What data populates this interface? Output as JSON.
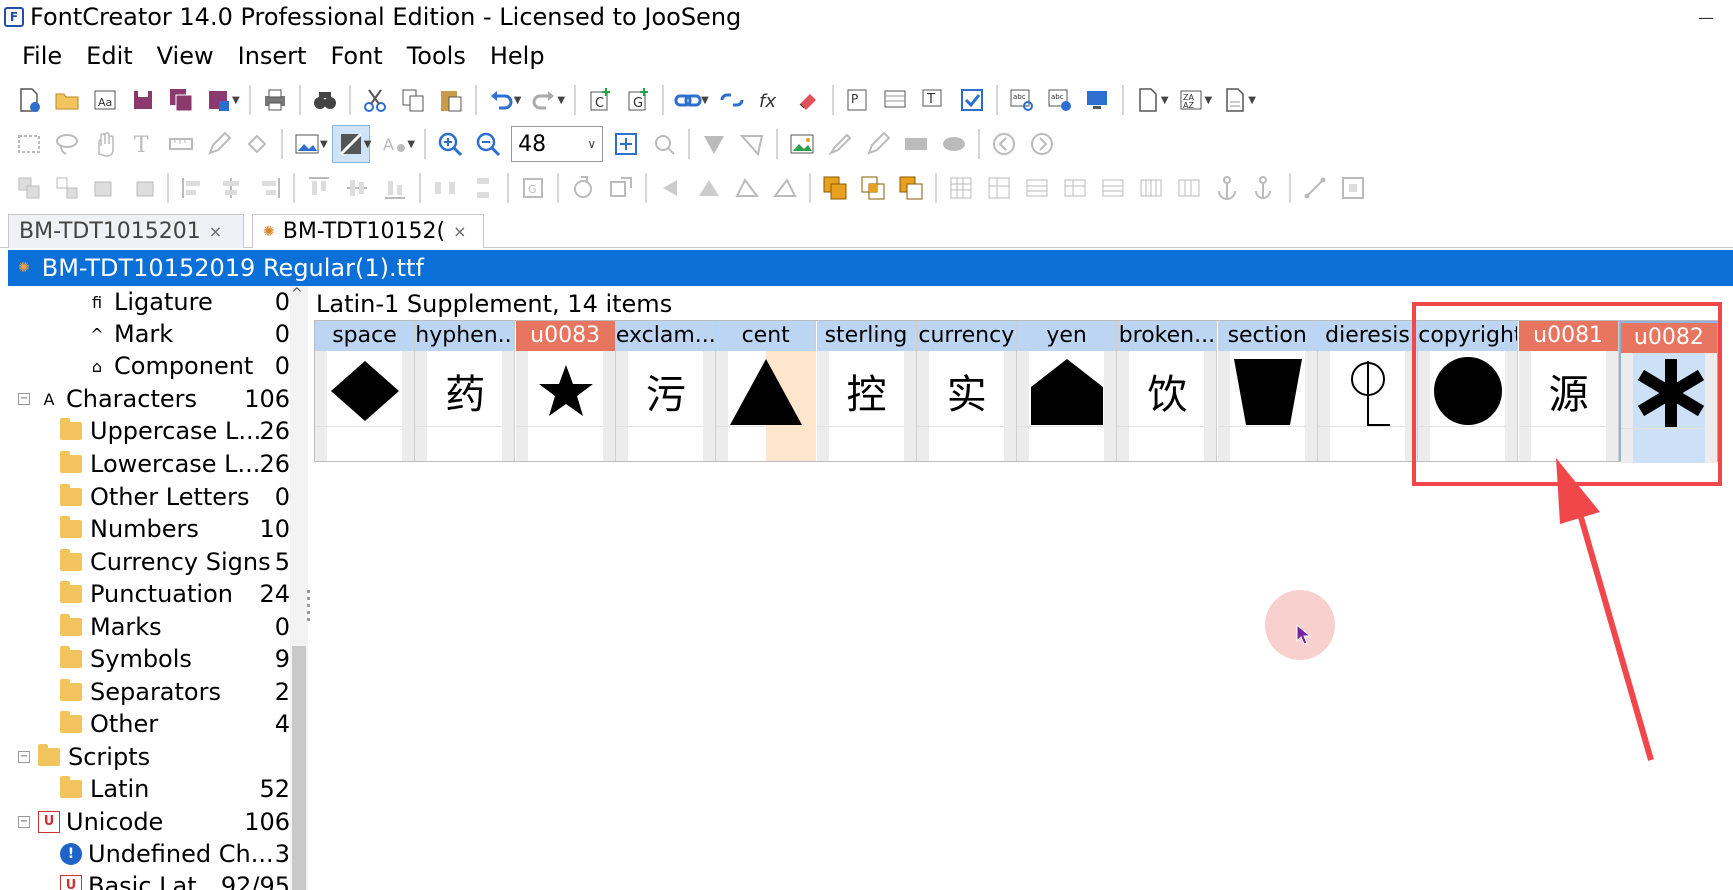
{
  "window": {
    "title": "FontCreator 14.0 Professional Edition - Licensed to JooSeng",
    "minimize": "—"
  },
  "menu": [
    "File",
    "Edit",
    "View",
    "Insert",
    "Font",
    "Tools",
    "Help"
  ],
  "toolbar": {
    "zoom_value": "48"
  },
  "tabs": [
    {
      "label": "BM-TDT1015201"
    },
    {
      "label": "BM-TDT10152("
    }
  ],
  "document": {
    "title": "BM-TDT10152019 Regular(1).ttf"
  },
  "tree": [
    {
      "label": "Ligature",
      "count": "0",
      "icon": "ligature-icon",
      "glyph": "ﬁ"
    },
    {
      "label": "Mark",
      "count": "0",
      "icon": "mark-icon",
      "glyph": "^"
    },
    {
      "label": "Component",
      "count": "0",
      "icon": "component-icon",
      "glyph": "⌂"
    },
    {
      "label": "Characters",
      "count": "106",
      "icon": "characters-icon",
      "glyph": "A"
    },
    {
      "label": "Uppercase L...",
      "count": "26",
      "icon": "folder-icon"
    },
    {
      "label": "Lowercase L...",
      "count": "26",
      "icon": "folder-icon"
    },
    {
      "label": "Other Letters",
      "count": "0",
      "icon": "folder-icon"
    },
    {
      "label": "Numbers",
      "count": "10",
      "icon": "folder-icon"
    },
    {
      "label": "Currency Signs",
      "count": "5",
      "icon": "folder-icon"
    },
    {
      "label": "Punctuation",
      "count": "24",
      "icon": "folder-icon"
    },
    {
      "label": "Marks",
      "count": "0",
      "icon": "folder-icon"
    },
    {
      "label": "Symbols",
      "count": "9",
      "icon": "folder-icon"
    },
    {
      "label": "Separators",
      "count": "2",
      "icon": "folder-icon"
    },
    {
      "label": "Other",
      "count": "4",
      "icon": "folder-icon"
    },
    {
      "label": "Scripts",
      "count": "",
      "icon": "folder-icon"
    },
    {
      "label": "Latin",
      "count": "52",
      "icon": "folder-icon"
    },
    {
      "label": "Unicode",
      "count": "106",
      "icon": "unicode-icon"
    },
    {
      "label": "Undefined Ch...",
      "count": "3",
      "icon": "info-icon"
    },
    {
      "label": "Basic Lat...",
      "count": "92/95",
      "icon": "unicode-icon"
    }
  ],
  "grid": {
    "section_title": "Latin-1 Supplement, 14 items",
    "glyphs": [
      {
        "name": "space",
        "status": "normal",
        "shape": "diamond"
      },
      {
        "name": "hyphen...",
        "status": "normal",
        "char": "药"
      },
      {
        "name": "u0083",
        "status": "warning",
        "shape": "star"
      },
      {
        "name": "exclam...",
        "status": "normal",
        "char": "污"
      },
      {
        "name": "cent",
        "status": "normal",
        "shape": "triangle"
      },
      {
        "name": "sterling",
        "status": "normal",
        "char": "控"
      },
      {
        "name": "currency",
        "status": "normal",
        "char": "实"
      },
      {
        "name": "yen",
        "status": "normal",
        "shape": "pentagon"
      },
      {
        "name": "broken...",
        "status": "normal",
        "char": "饮"
      },
      {
        "name": "section",
        "status": "normal",
        "shape": "trapezoid"
      },
      {
        "name": "dieresis",
        "status": "normal",
        "shape": "pin"
      },
      {
        "name": "copyright",
        "status": "normal",
        "shape": "circle"
      },
      {
        "name": "u0081",
        "status": "warning",
        "char": "源"
      },
      {
        "name": "u0082",
        "status": "warning",
        "shape": "asterisk"
      }
    ]
  },
  "colors": {
    "accent_blue": "#0a6fd6",
    "header_blue": "#bcd5f3",
    "warning_red": "#e8755f",
    "annotation_red": "#f0474a"
  }
}
